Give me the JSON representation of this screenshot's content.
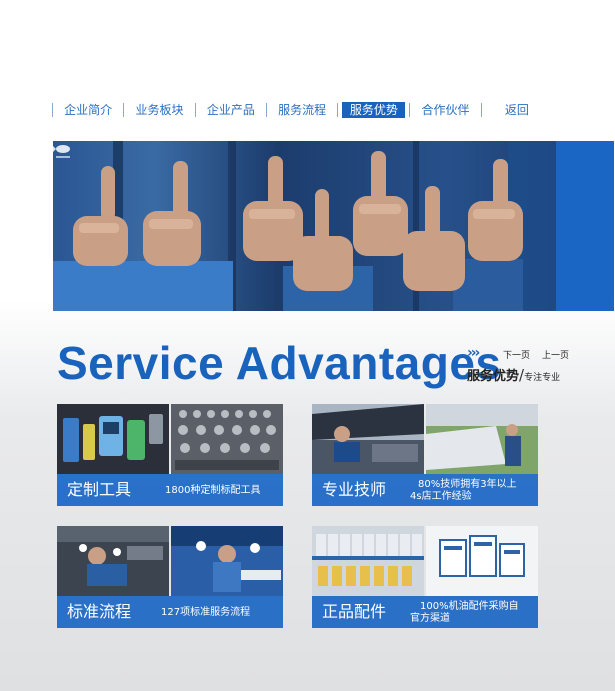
{
  "nav": {
    "items": [
      {
        "label": "企业简介"
      },
      {
        "label": "业务板块"
      },
      {
        "label": "企业产品"
      },
      {
        "label": "服务流程"
      },
      {
        "label": "服务优势",
        "active": true
      },
      {
        "label": "合作伙伴"
      },
      {
        "label": "返回"
      }
    ]
  },
  "banner": {
    "image": "thumbs-up-hands-photo",
    "logo": "fish-logo-icon"
  },
  "heading": {
    "title": "Service  Advantages",
    "arrows": "›››",
    "next": "下一页",
    "prev": "上一页",
    "subtitle": "服务优势",
    "slash": "/",
    "tag": "专注专业"
  },
  "cards": [
    {
      "title": "定制工具",
      "desc_line1": "1800种定制标配工具",
      "desc_line2": ""
    },
    {
      "title": "专业技师",
      "desc_line1": "80%技师拥有3年以上",
      "desc_line2": "4s店工作经验"
    },
    {
      "title": "标准流程",
      "desc_line1": "127项标准服务流程",
      "desc_line2": ""
    },
    {
      "title": "正品配件",
      "desc_line1": "100%机油配件采购自",
      "desc_line2": "官方渠道"
    }
  ],
  "colors": {
    "accent": "#1a63bd",
    "bar": "#1a66c4",
    "navText": "#2b6fc2"
  }
}
